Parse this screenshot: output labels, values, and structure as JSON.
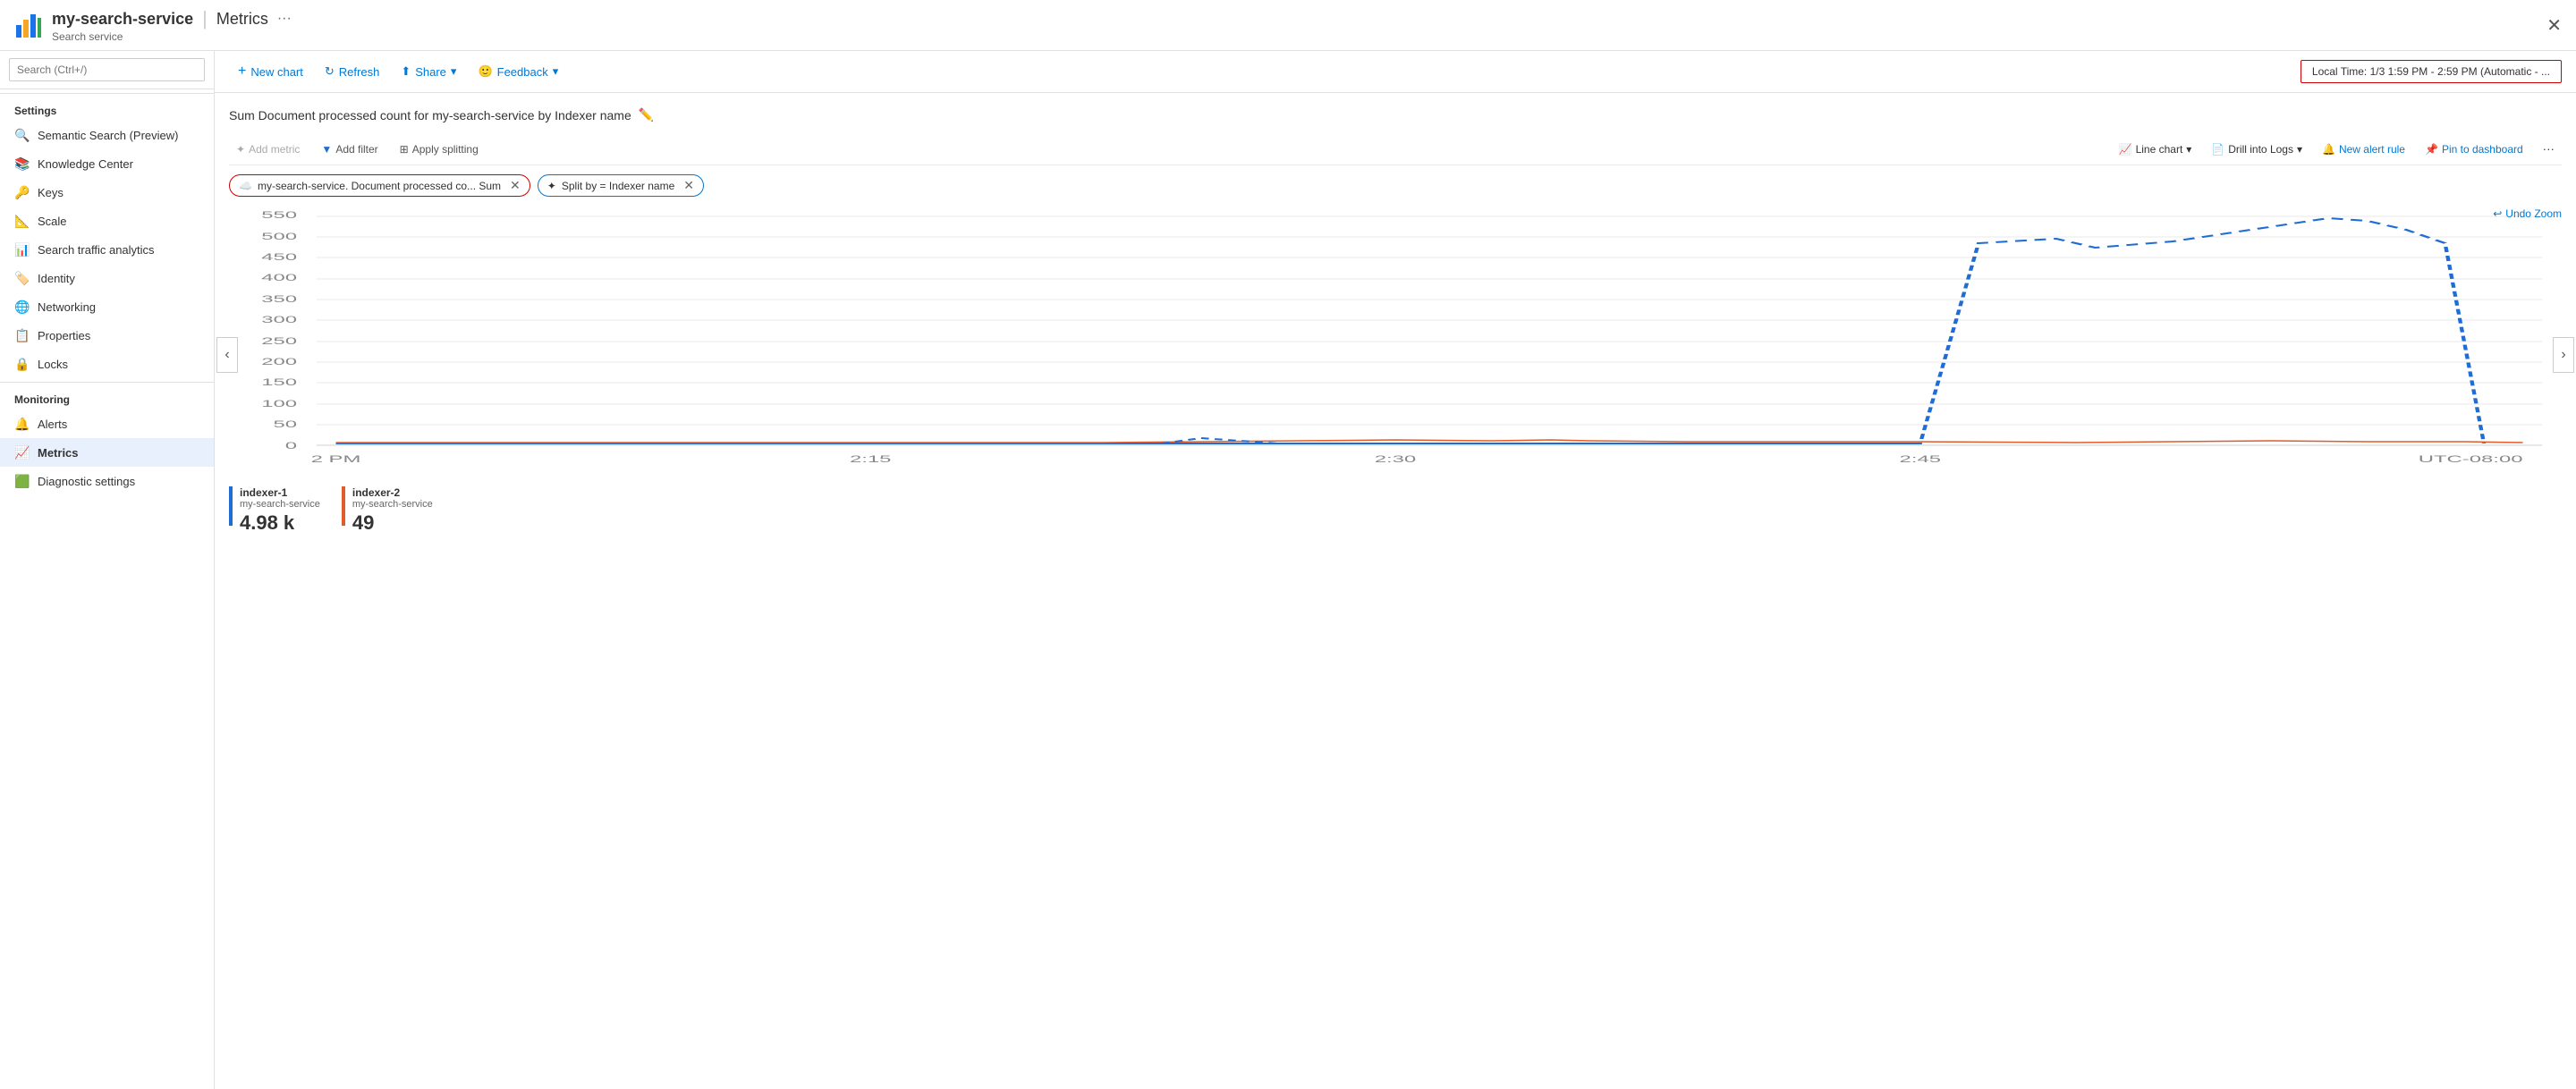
{
  "header": {
    "service_name": "my-search-service",
    "separator": "|",
    "page_title": "Metrics",
    "subtitle": "Search service",
    "dots": "···",
    "close": "✕"
  },
  "sidebar": {
    "search_placeholder": "Search (Ctrl+/)",
    "collapse_icon": "«",
    "sections": [
      {
        "title": "Settings",
        "items": [
          {
            "label": "Semantic Search (Preview)",
            "icon": "🔍",
            "active": false
          },
          {
            "label": "Knowledge Center",
            "icon": "📚",
            "active": false
          },
          {
            "label": "Keys",
            "icon": "🔑",
            "active": false
          },
          {
            "label": "Scale",
            "icon": "📐",
            "active": false
          },
          {
            "label": "Search traffic analytics",
            "icon": "📊",
            "active": false
          },
          {
            "label": "Identity",
            "icon": "🏷️",
            "active": false
          },
          {
            "label": "Networking",
            "icon": "🌐",
            "active": false
          },
          {
            "label": "Properties",
            "icon": "📋",
            "active": false
          },
          {
            "label": "Locks",
            "icon": "🔒",
            "active": false
          }
        ]
      },
      {
        "title": "Monitoring",
        "items": [
          {
            "label": "Alerts",
            "icon": "🔔",
            "active": false
          },
          {
            "label": "Metrics",
            "icon": "📈",
            "active": true
          },
          {
            "label": "Diagnostic settings",
            "icon": "🟩",
            "active": false
          }
        ]
      }
    ]
  },
  "toolbar": {
    "new_chart": "New chart",
    "refresh": "Refresh",
    "share": "Share",
    "share_chevron": "▾",
    "feedback": "Feedback",
    "feedback_chevron": "▾",
    "time_range": "Local Time: 1/3 1:59 PM - 2:59 PM (Automatic - ..."
  },
  "chart": {
    "title": "Sum Document processed count for my-search-service by Indexer name",
    "edit_icon": "✏️",
    "metrics_toolbar": {
      "add_metric": "Add metric",
      "add_filter": "Add filter",
      "apply_splitting": "Apply splitting",
      "line_chart": "Line chart",
      "line_chart_chevron": "▾",
      "drill_into_logs": "Drill into Logs",
      "drill_chevron": "▾",
      "new_alert_rule": "New alert rule",
      "pin_to_dashboard": "Pin to dashboard",
      "more_dots": "···"
    },
    "chips": [
      {
        "icon": "☁️",
        "label": "my-search-service. Document processed co...  Sum",
        "close": "✕",
        "border": "red"
      },
      {
        "icon": "✦",
        "label": "Split by = Indexer name",
        "close": "✕",
        "border": "blue"
      }
    ],
    "undo_zoom": "↩ Undo Zoom",
    "y_axis": [
      "550",
      "500",
      "450",
      "400",
      "350",
      "300",
      "250",
      "200",
      "150",
      "100",
      "50",
      "0"
    ],
    "x_axis": [
      "2 PM",
      "2:15",
      "2:30",
      "2:45",
      "UTC-08:00"
    ],
    "legend": [
      {
        "name": "indexer-1",
        "service": "my-search-service",
        "value": "4.98 k",
        "color": "#1f6dd4"
      },
      {
        "name": "indexer-2",
        "service": "my-search-service",
        "value": "49",
        "color": "#e05c2a"
      }
    ]
  }
}
